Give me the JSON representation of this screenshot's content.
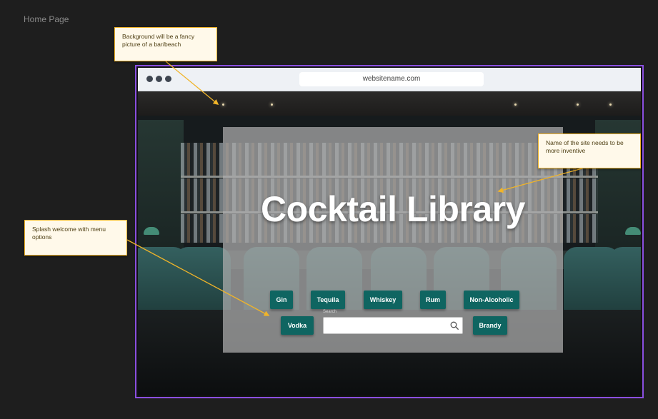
{
  "frame": {
    "label": "Home Page"
  },
  "browser": {
    "url": "websitename.com"
  },
  "hero": {
    "title": "Cocktail Library",
    "menu": {
      "gin": "Gin",
      "tequila": "Tequila",
      "whiskey": "Whiskey",
      "rum": "Rum",
      "non_alcoholic": "Non-Alcoholic",
      "vodka": "Vodka",
      "brandy": "Brandy"
    },
    "search": {
      "label": "Search",
      "value": "",
      "placeholder": ""
    }
  },
  "annotations": {
    "background": "Background will be a fancy picture of a bar/beach",
    "site_name": "Name of the site needs to be more inventive",
    "splash": "Splash welcome with menu options"
  },
  "colors": {
    "accent": "#8a4fe0",
    "button": "#0f6561",
    "note_border": "#f0b429",
    "note_fill": "#fff9ea",
    "arrow": "#f0b429"
  },
  "icons": {
    "search": "search-icon",
    "window_controls": "window-dot-icon"
  }
}
